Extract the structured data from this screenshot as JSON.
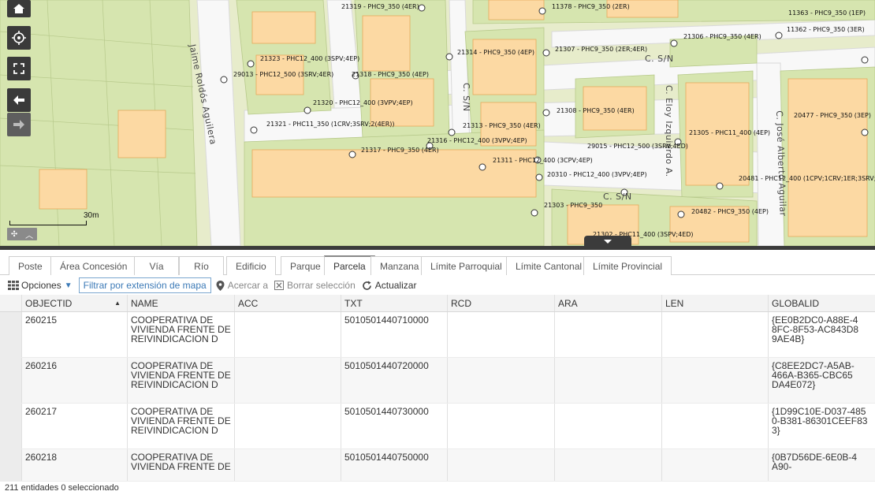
{
  "map": {
    "scale_label": "30m",
    "streets": [
      {
        "text": "Jaime Roldós Aguilera"
      },
      {
        "text": "C. S/N"
      },
      {
        "text": "C. S/N"
      },
      {
        "text": "C. S/N"
      },
      {
        "text": "C. Eloy Izquierdo A."
      },
      {
        "text": "C. José Alberto Aguilar"
      }
    ],
    "labels": [
      "21319 - PHC9_350 (4ER)",
      "11378 - PHC9_350 (2ER)",
      "11363 - PHC9_350 (1EP)",
      "11362 - PHC9_350 (3ER)",
      "21306 - PHC9_350 (4ER)",
      "21307 - PHC9_350 (2ER;4ER)",
      "21314 - PHC9_350 (4EP)",
      "21323 - PHC12_400 (3SPV;4EP)",
      "29013 - PHC12_500 (3SRV;4ER)",
      "21318 - PHC9_350 (4EP)",
      "21320 - PHC12_400 (3VPV;4EP)",
      "21321 - PHC11_350 (1CRV;3SRV;2(4ER))",
      "21308 - PHC9_350 (4ER)",
      "21313 - PHC9_350 (4ER)",
      "21316 - PHC12_400 (3VPV;4EP)",
      "21317 - PHC9_350 (4ER)",
      "21311 - PHC12_400 (3CPV;4EP)",
      "29015 - PHC12_500 (3SRV;4ED)",
      "20310 - PHC12_400 (3VPV;4EP)",
      "21305 - PHC11_400 (4EP)",
      "20477 - PHC9_350 (3EP)",
      "20481 - PHC12_400 (1CPV;1CRV;1ER;3SRV;",
      "21303 - PHC9_350",
      "20482 - PHC9_350 (4EP)",
      "21302 - PHC11_400 (3SPV;4ED)"
    ]
  },
  "tabs": [
    "Poste",
    "Área Concesión",
    "Vía",
    "Río",
    "Edificio",
    "Parque",
    "Parcela",
    "Manzana",
    "Límite Parroquial",
    "Límite Cantonal",
    "Límite Provincial"
  ],
  "active_tab": "Parcela",
  "toolbar": {
    "options": "Opciones",
    "filter": "Filtrar por extensión de mapa",
    "zoom_to": "Acercar a",
    "clear_selection": "Borrar selección",
    "refresh": "Actualizar"
  },
  "table": {
    "columns": [
      "OBJECTID",
      "NAME",
      "ACC",
      "TXT",
      "RCD",
      "ARA",
      "LEN",
      "GLOBALID"
    ],
    "rows": [
      {
        "objectid": "260215",
        "name": "COOPERATIVA DE VIVIENDA FRENTE DE REIVINDICACION D",
        "acc": "",
        "txt": "5010501440710000",
        "rcd": "",
        "ara": "",
        "len": "",
        "globalid": "{EE0B2DC0-A88E-48FC-8F53-AC843D89AE4B}"
      },
      {
        "objectid": "260216",
        "name": "COOPERATIVA DE VIVIENDA FRENTE DE REIVINDICACION D",
        "acc": "",
        "txt": "5010501440720000",
        "rcd": "",
        "ara": "",
        "len": "",
        "globalid": "{C8EE2DC7-A5AB-466A-B365-CBC65DA4E072}"
      },
      {
        "objectid": "260217",
        "name": "COOPERATIVA DE VIVIENDA FRENTE DE REIVINDICACION D",
        "acc": "",
        "txt": "5010501440730000",
        "rcd": "",
        "ara": "",
        "len": "",
        "globalid": "{1D99C10E-D037-4850-B381-86301CEEF833}"
      },
      {
        "objectid": "260218",
        "name": "COOPERATIVA DE VIVIENDA FRENTE DE",
        "acc": "",
        "txt": "5010501440750000",
        "rcd": "",
        "ara": "",
        "len": "",
        "globalid": "{0B7D56DE-6E0B-4A90-"
      }
    ]
  },
  "status": "211 entidades 0 seleccionado",
  "colors": {
    "map_bg": "#e7eccb",
    "road": "#ffffff",
    "parcel_fill": "#d3e3ad",
    "building": "#fcd9a3",
    "building_stroke": "#e7a95b",
    "accent": "#3c7ab7"
  }
}
